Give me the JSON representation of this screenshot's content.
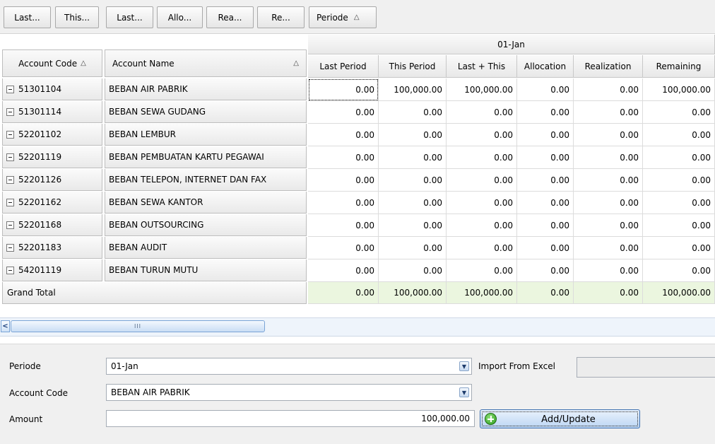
{
  "field_buttons": [
    "Last...",
    "This...",
    "Last...",
    "Allo...",
    "Rea...",
    "Re..."
  ],
  "periode_field": {
    "label": "Periode",
    "sort": "△"
  },
  "column_group": "01-Jan",
  "row_headers": {
    "account_code": "Account Code",
    "account_name": "Account Name",
    "sort": "△"
  },
  "columns": [
    "Last Period",
    "This Period",
    "Last + This",
    "Allocation",
    "Realization",
    "Remaining"
  ],
  "rows": [
    {
      "code": "51301104",
      "name": "BEBAN AIR PABRIK",
      "values": [
        "0.00",
        "100,000.00",
        "100,000.00",
        "0.00",
        "0.00",
        "100,000.00"
      ]
    },
    {
      "code": "51301114",
      "name": "BEBAN SEWA GUDANG",
      "values": [
        "0.00",
        "0.00",
        "0.00",
        "0.00",
        "0.00",
        "0.00"
      ]
    },
    {
      "code": "52201102",
      "name": "BEBAN LEMBUR",
      "values": [
        "0.00",
        "0.00",
        "0.00",
        "0.00",
        "0.00",
        "0.00"
      ]
    },
    {
      "code": "52201119",
      "name": "BEBAN PEMBUATAN KARTU PEGAWAI",
      "values": [
        "0.00",
        "0.00",
        "0.00",
        "0.00",
        "0.00",
        "0.00"
      ]
    },
    {
      "code": "52201126",
      "name": "BEBAN TELEPON, INTERNET DAN FAX",
      "values": [
        "0.00",
        "0.00",
        "0.00",
        "0.00",
        "0.00",
        "0.00"
      ]
    },
    {
      "code": "52201162",
      "name": "BEBAN SEWA KANTOR",
      "values": [
        "0.00",
        "0.00",
        "0.00",
        "0.00",
        "0.00",
        "0.00"
      ]
    },
    {
      "code": "52201168",
      "name": "BEBAN OUTSOURCING",
      "values": [
        "0.00",
        "0.00",
        "0.00",
        "0.00",
        "0.00",
        "0.00"
      ]
    },
    {
      "code": "52201183",
      "name": "BEBAN AUDIT",
      "values": [
        "0.00",
        "0.00",
        "0.00",
        "0.00",
        "0.00",
        "0.00"
      ]
    },
    {
      "code": "54201119",
      "name": "BEBAN TURUN MUTU",
      "values": [
        "0.00",
        "0.00",
        "0.00",
        "0.00",
        "0.00",
        "0.00"
      ]
    }
  ],
  "grand_total": {
    "label": "Grand Total",
    "values": [
      "0.00",
      "100,000.00",
      "100,000.00",
      "0.00",
      "0.00",
      "100,000.00"
    ]
  },
  "scrollbar": {
    "left_arrow": "<",
    "thumb_grip": "III"
  },
  "form": {
    "periode_label": "Periode",
    "periode_value": "01-Jan",
    "import_label": "Import From Excel",
    "import_value": "",
    "account_code_label": "Account Code",
    "account_code_value": "BEBAN AIR PABRIK",
    "amount_label": "Amount",
    "amount_value": "100,000.00",
    "add_button": "Add/Update"
  },
  "colors": {
    "total_row": "#ebf6df",
    "accent_blue": "#3c6fb0",
    "add_icon": "#2a9a1a"
  },
  "icons": {
    "expand": "minus-box-icon",
    "dropdown": "chevron-down-icon",
    "add": "plus-circle-icon",
    "scroll": "arrow-left-icon"
  }
}
